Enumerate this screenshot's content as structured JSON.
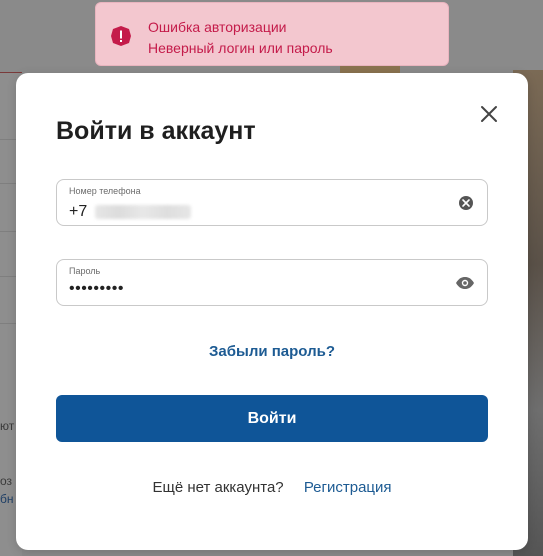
{
  "toast": {
    "icon": "error-icon",
    "title": "Ошибка авторизации",
    "message": "Неверный логин или пароль",
    "accent": "#c41b4a",
    "background": "#f3c7cf"
  },
  "modal": {
    "title": "Войти в аккаунт",
    "close_icon": "close-icon",
    "phone": {
      "label": "Номер телефона",
      "prefix": "+7"
    },
    "password": {
      "label": "Пароль",
      "value_masked": "•••••••••",
      "toggle_icon": "eye-icon"
    },
    "forgot_link": "Забыли пароль?",
    "login_button": "Войти",
    "register_question": "Ещё нет аккаунта?",
    "register_link": "Регистрация",
    "primary_color": "#0f5598",
    "link_color": "#1d5b93"
  },
  "background": {
    "snippet_1": "ют",
    "snippet_2": "оз",
    "snippet_3": "бн"
  }
}
